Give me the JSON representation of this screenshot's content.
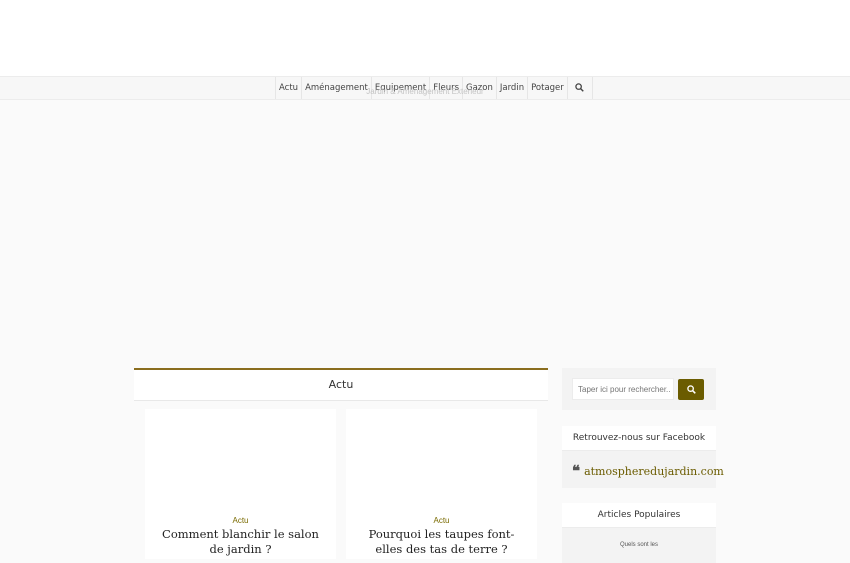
{
  "nav": {
    "items": [
      "Actu",
      "Aménagement",
      "Equipement",
      "Fleurs",
      "Gazon",
      "Jardin",
      "Potager"
    ]
  },
  "site": {
    "tagline": "Jardin & Aménagement Exterieur"
  },
  "main": {
    "section_title": "Actu",
    "posts": [
      {
        "category": "Actu",
        "title": "Comment blanchir le salon de jardin ?"
      },
      {
        "category": "Actu",
        "title": "Pourquoi les taupes font-elles des tas de terre ?"
      }
    ]
  },
  "sidebar": {
    "search_placeholder": "Taper ici pour rechercher...",
    "facebook_title": "Retrouvez-nous sur Facebook",
    "facebook_link": "atmospheredujardin.com",
    "popular_title": "Articles Populaires",
    "popular_first": "Quels sont les"
  },
  "colors": {
    "accent": "#6b5c00",
    "section_border": "#8a6d1e"
  },
  "icons": {
    "search": "search-icon",
    "quote": "quote-icon"
  }
}
